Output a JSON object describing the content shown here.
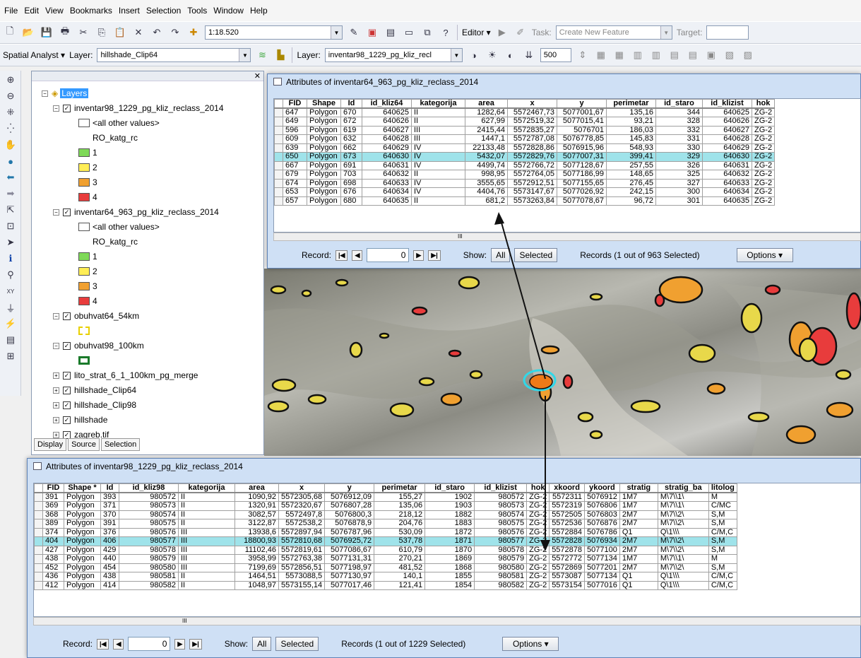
{
  "menu": [
    "File",
    "Edit",
    "View",
    "Bookmarks",
    "Insert",
    "Selection",
    "Tools",
    "Window",
    "Help"
  ],
  "toolbar": {
    "scale": "1:18.520",
    "editor": "Editor ▾",
    "task_label": "Task:",
    "task_value": "Create New Feature",
    "target_label": "Target:"
  },
  "spatial": {
    "label": "Spatial Analyst ▾",
    "layer_label": "Layer:",
    "layer_value": "hillshade_Clip64",
    "layer2_label": "Layer:",
    "layer2_value": "inventar98_1229_pg_kliz_recl",
    "value_500": "500"
  },
  "toc": {
    "root": "Layers",
    "layers": [
      {
        "name": "inventar98_1229_pg_kliz_reclass_2014",
        "other": "<all other values>",
        "field": "RO_katg_rc",
        "classes": [
          "1",
          "2",
          "3",
          "4"
        ]
      },
      {
        "name": "inventar64_963_pg_kliz_reclass_2014",
        "other": "<all other values>",
        "field": "RO_katg_rc",
        "classes": [
          "1",
          "2",
          "3",
          "4"
        ]
      },
      {
        "name": "obuhvat64_54km"
      },
      {
        "name": "obuhvat98_100km"
      },
      {
        "name": "lito_strat_6_1_100km_pg_merge"
      },
      {
        "name": "hillshade_Clip64"
      },
      {
        "name": "hillshade_Clip98"
      },
      {
        "name": "hillshade"
      },
      {
        "name": "zagreb.tif"
      }
    ],
    "tabs": [
      "Display",
      "Source",
      "Selection"
    ],
    "class_colors": [
      "#7ed957",
      "#ffee55",
      "#f0a030",
      "#e83c3c"
    ]
  },
  "table1": {
    "title": "Attributes of inventar64_963_pg_kliz_reclass_2014",
    "columns": [
      "FID",
      "Shape",
      "Id",
      "id_kliz64",
      "kategorija",
      "area",
      "x",
      "y",
      "perimetar",
      "id_staro",
      "id_klizist",
      "hok"
    ],
    "rows": [
      [
        "647",
        "Polygon",
        "670",
        "640625",
        "II",
        "1282,64",
        "5572467,73",
        "5077001,67",
        "135,16",
        "344",
        "640625",
        "ZG-2"
      ],
      [
        "649",
        "Polygon",
        "672",
        "640626",
        "II",
        "627,99",
        "5572519,32",
        "5077015,41",
        "93,21",
        "328",
        "640626",
        "ZG-2"
      ],
      [
        "596",
        "Polygon",
        "619",
        "640627",
        "III",
        "2415,44",
        "5572835,27",
        "5076701",
        "186,03",
        "332",
        "640627",
        "ZG-2"
      ],
      [
        "609",
        "Polygon",
        "632",
        "640628",
        "III",
        "1447,1",
        "5572787,08",
        "5076778,85",
        "145,83",
        "331",
        "640628",
        "ZG-2"
      ],
      [
        "639",
        "Polygon",
        "662",
        "640629",
        "IV",
        "22133,48",
        "5572828,86",
        "5076915,96",
        "548,93",
        "330",
        "640629",
        "ZG-2"
      ],
      [
        "650",
        "Polygon",
        "673",
        "640630",
        "IV",
        "5432,07",
        "5572829,76",
        "5077007,31",
        "399,41",
        "329",
        "640630",
        "ZG-2"
      ],
      [
        "667",
        "Polygon",
        "691",
        "640631",
        "IV",
        "4499,74",
        "5572766,72",
        "5077128,67",
        "257,55",
        "326",
        "640631",
        "ZG-2"
      ],
      [
        "679",
        "Polygon",
        "703",
        "640632",
        "II",
        "998,95",
        "5572764,05",
        "5077186,99",
        "148,65",
        "325",
        "640632",
        "ZG-2"
      ],
      [
        "674",
        "Polygon",
        "698",
        "640633",
        "IV",
        "3555,65",
        "5572912,51",
        "5077155,65",
        "276,45",
        "327",
        "640633",
        "ZG-2"
      ],
      [
        "653",
        "Polygon",
        "676",
        "640634",
        "IV",
        "4404,76",
        "5573147,67",
        "5077026,92",
        "242,15",
        "300",
        "640634",
        "ZG-2"
      ],
      [
        "657",
        "Polygon",
        "680",
        "640635",
        "II",
        "681,2",
        "5573263,84",
        "5077078,67",
        "96,72",
        "301",
        "640635",
        "ZG-2"
      ]
    ],
    "selected_row": 5,
    "record_label": "Record:",
    "record_value": "0",
    "show_label": "Show:",
    "all": "All",
    "selected": "Selected",
    "status": "Records (1 out of 963 Selected)",
    "options": "Options ▾",
    "scroll_mark": "III"
  },
  "table2": {
    "title": "Attributes of inventar98_1229_pg_kliz_reclass_2014",
    "columns": [
      "FID",
      "Shape *",
      "Id",
      "id_kliz98",
      "kategorija",
      "area",
      "x",
      "y",
      "perimetar",
      "id_staro",
      "id_klizist",
      "hok",
      "xkoord",
      "ykoord",
      "stratig",
      "stratig_ba",
      "litolog"
    ],
    "rows": [
      [
        "391",
        "Polygon",
        "393",
        "980572",
        "II",
        "1090,92",
        "5572305,68",
        "5076912,09",
        "155,27",
        "1902",
        "980572",
        "ZG-2",
        "5572311",
        "5076912",
        "1M7",
        "M\\7\\\\1\\",
        "M"
      ],
      [
        "369",
        "Polygon",
        "371",
        "980573",
        "II",
        "1320,91",
        "5572320,67",
        "5076807,28",
        "135,06",
        "1903",
        "980573",
        "ZG-2",
        "5572319",
        "5076806",
        "1M7",
        "M\\7\\\\1\\",
        "C/MC"
      ],
      [
        "368",
        "Polygon",
        "370",
        "980574",
        "II",
        "3082,57",
        "5572497,8",
        "5076800,3",
        "218,12",
        "1882",
        "980574",
        "ZG-2",
        "5572505",
        "5076803",
        "2M7",
        "M\\7\\\\2\\",
        "S,M"
      ],
      [
        "389",
        "Polygon",
        "391",
        "980575",
        "II",
        "3122,87",
        "5572538,2",
        "5076878,9",
        "204,76",
        "1883",
        "980575",
        "ZG-2",
        "5572536",
        "5076876",
        "2M7",
        "M\\7\\\\2\\",
        "S,M"
      ],
      [
        "374",
        "Polygon",
        "376",
        "980576",
        "III",
        "13938,6",
        "5572897,94",
        "5076787,96",
        "530,09",
        "1872",
        "980576",
        "ZG-2",
        "5572884",
        "5076786",
        "Q1",
        "Q\\1\\\\\\",
        "C/M,C"
      ],
      [
        "404",
        "Polygon",
        "406",
        "980577",
        "III",
        "18800,93",
        "5572810,68",
        "5076925,72",
        "537,78",
        "1871",
        "980577",
        "ZG-2",
        "5572828",
        "5076934",
        "2M7",
        "M\\7\\\\2\\",
        "S,M"
      ],
      [
        "427",
        "Polygon",
        "429",
        "980578",
        "III",
        "11102,46",
        "5572819,61",
        "5077086,67",
        "610,79",
        "1870",
        "980578",
        "ZG-2",
        "5572878",
        "5077100",
        "2M7",
        "M\\7\\\\2\\",
        "S,M"
      ],
      [
        "438",
        "Polygon",
        "440",
        "980579",
        "III",
        "3958,99",
        "5572763,38",
        "5077131,31",
        "270,21",
        "1869",
        "980579",
        "ZG-2",
        "5572772",
        "5077134",
        "1M7",
        "M\\7\\\\1\\",
        "M"
      ],
      [
        "452",
        "Polygon",
        "454",
        "980580",
        "III",
        "7199,69",
        "5572856,51",
        "5077198,97",
        "481,52",
        "1868",
        "980580",
        "ZG-2",
        "5572869",
        "5077201",
        "2M7",
        "M\\7\\\\2\\",
        "S,M"
      ],
      [
        "436",
        "Polygon",
        "438",
        "980581",
        "II",
        "1464,51",
        "5573088,5",
        "5077130,97",
        "140,1",
        "1855",
        "980581",
        "ZG-2",
        "5573087",
        "5077134",
        "Q1",
        "Q\\1\\\\\\",
        "C/M,C"
      ],
      [
        "412",
        "Polygon",
        "414",
        "980582",
        "II",
        "1048,97",
        "5573155,14",
        "5077017,46",
        "121,41",
        "1854",
        "980582",
        "ZG-2",
        "5573154",
        "5077016",
        "Q1",
        "Q\\1\\\\\\",
        "C/M,C"
      ]
    ],
    "selected_row": 5,
    "record_label": "Record:",
    "record_value": "0",
    "show_label": "Show:",
    "all": "All",
    "selected": "Selected",
    "status": "Records (1 out of 1229 Selected)",
    "options": "Options ▾",
    "scroll_mark": "III"
  }
}
